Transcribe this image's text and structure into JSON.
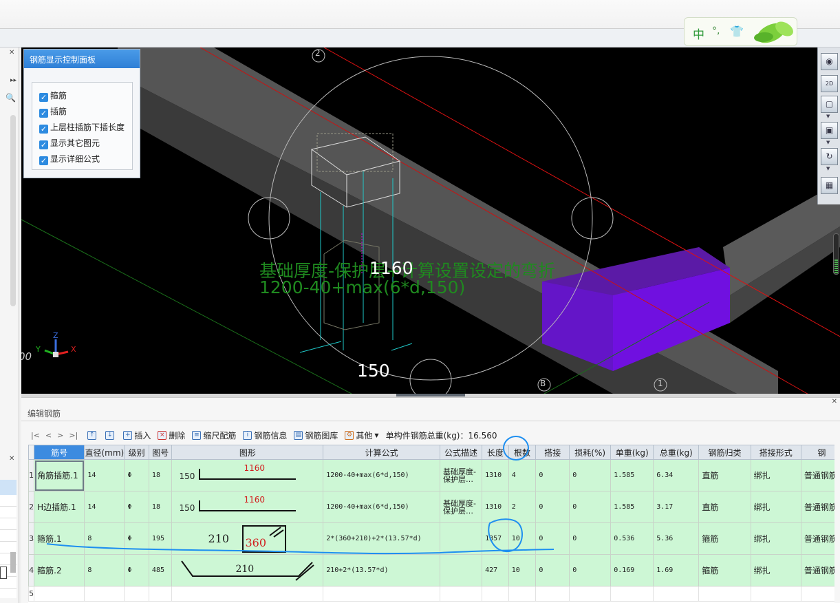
{
  "ime": {
    "lang": "中",
    "punct": "°,",
    "skin": "👕"
  },
  "control_panel": {
    "title": "钢筋显示控制面板",
    "options": [
      {
        "label": "箍筋",
        "checked": true
      },
      {
        "label": "插筋",
        "checked": true
      },
      {
        "label": "上层柱插筋下插长度",
        "checked": true
      },
      {
        "label": "显示其它图元",
        "checked": true
      },
      {
        "label": "显示详细公式",
        "checked": true
      }
    ]
  },
  "viewport": {
    "axis_labels": {
      "top": "2",
      "bottom_b": "B",
      "bottom_1": "1"
    },
    "formula_line1": "基础厚度-保护层+计算设置设定的弯折",
    "formula_line2": "1200-40+max(6*d,150)",
    "dim_1160": "1160",
    "dim_150": "150",
    "left_edge_text": "00",
    "gizmo": {
      "x": "X",
      "y": "Y",
      "z": "Z"
    }
  },
  "right_toolbar": {
    "btn_2d": "2D"
  },
  "editor": {
    "title": "编辑钢筋",
    "nav": [
      "|<",
      "<",
      ">",
      ">|"
    ],
    "toolbar": {
      "insert": "插入",
      "delete": "删除",
      "scale": "缩尺配筋",
      "info": "钢筋信息",
      "library": "钢筋图库",
      "other": "其他",
      "total_label": "单构件钢筋总重(kg)：16.560"
    },
    "columns": [
      "筋号",
      "直径(mm)",
      "级别",
      "图号",
      "图形",
      "计算公式",
      "公式描述",
      "长度",
      "根数",
      "搭接",
      "损耗(%)",
      "单重(kg)",
      "总重(kg)",
      "钢筋归类",
      "搭接形式",
      "钢"
    ],
    "rows": [
      {
        "n": "1",
        "name": "角筋插筋.1",
        "dia": "14",
        "grade": "Φ",
        "fig": "18",
        "shape_left": "150",
        "shape_top": "1160",
        "formula": "1200-40+max(6*d,150)",
        "desc1": "基础厚度-",
        "desc2": "保护层…",
        "len": "1310",
        "count": "4",
        "lap": "0",
        "loss": "0",
        "unit": "1.585",
        "total": "6.34",
        "cat": "直筋",
        "lapform": "绑扎",
        "type": "普通钢筋"
      },
      {
        "n": "2",
        "name": "H边插筋.1",
        "dia": "14",
        "grade": "Φ",
        "fig": "18",
        "shape_left": "150",
        "shape_top": "1160",
        "formula": "1200-40+max(6*d,150)",
        "desc1": "基础厚度-",
        "desc2": "保护层…",
        "len": "1310",
        "count": "2",
        "lap": "0",
        "loss": "0",
        "unit": "1.585",
        "total": "3.17",
        "cat": "直筋",
        "lapform": "绑扎",
        "type": "普通钢筋"
      },
      {
        "n": "3",
        "name": "箍筋.1",
        "dia": "8",
        "grade": "Φ",
        "fig": "195",
        "shape_left": "210",
        "shape_top": "360",
        "formula": "2*(360+210)+2*(13.57*d)",
        "desc1": "",
        "desc2": "",
        "len": "1357",
        "count": "10",
        "lap": "0",
        "loss": "0",
        "unit": "0.536",
        "total": "5.36",
        "cat": "箍筋",
        "lapform": "绑扎",
        "type": "普通钢筋"
      },
      {
        "n": "4",
        "name": "箍筋.2",
        "dia": "8",
        "grade": "Φ",
        "fig": "485",
        "shape_left": "",
        "shape_top": "210",
        "formula": "210+2*(13.57*d)",
        "desc1": "",
        "desc2": "",
        "len": "427",
        "count": "10",
        "lap": "0",
        "loss": "0",
        "unit": "0.169",
        "total": "1.69",
        "cat": "箍筋",
        "lapform": "绑扎",
        "type": "普通钢筋"
      }
    ],
    "empty_row_num": "5"
  },
  "colors": {
    "accent": "#2f7fd6",
    "row_bg": "#cdf7d5",
    "purple": "#6a0fd6",
    "formula_green": "#1f8a1f",
    "annotation": "#1e8ff0"
  }
}
